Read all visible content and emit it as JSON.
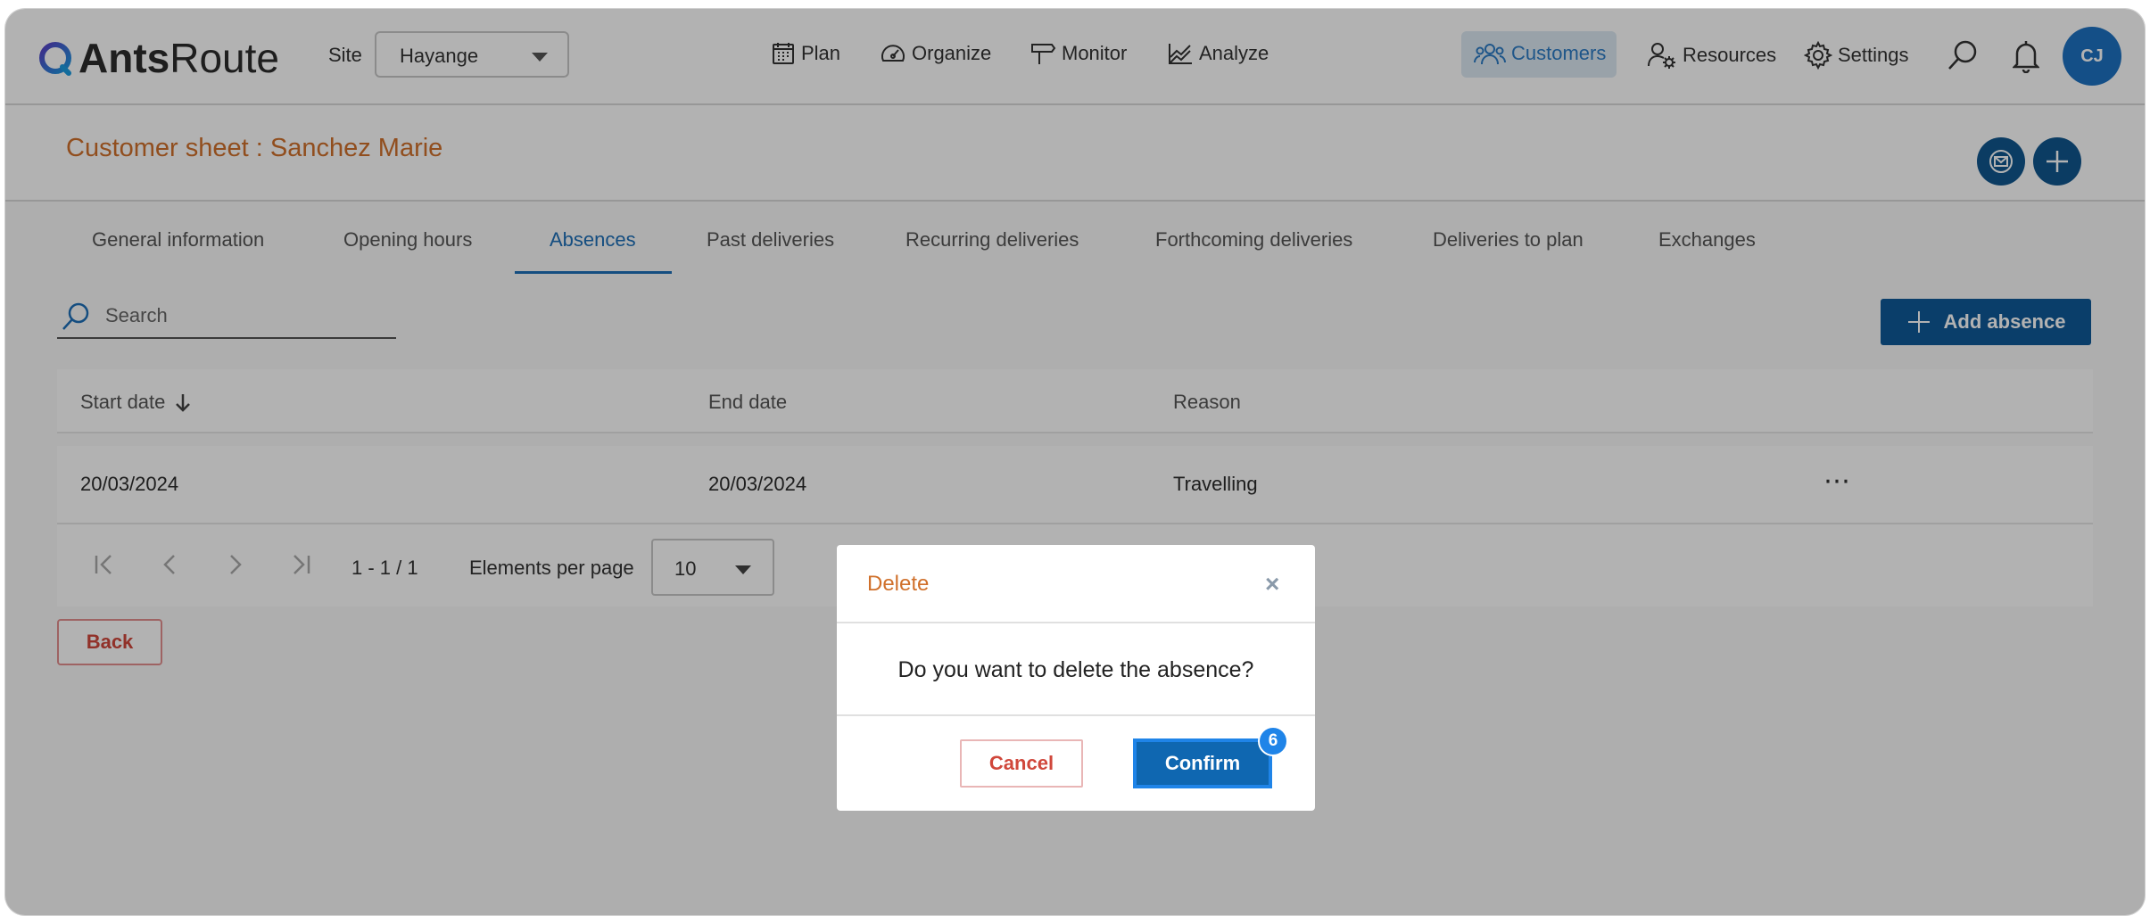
{
  "app": {
    "logo_bold": "Ants",
    "logo_light": "Route"
  },
  "topbar": {
    "site_label": "Site",
    "site_value": "Hayange",
    "nav": {
      "plan": "Plan",
      "organize": "Organize",
      "monitor": "Monitor",
      "analyze": "Analyze",
      "customers": "Customers",
      "resources": "Resources",
      "settings": "Settings"
    },
    "avatar_initials": "CJ",
    "accent_color": "#1d72c2"
  },
  "page": {
    "title": "Customer sheet : Sanchez Marie"
  },
  "tabs": [
    {
      "label": "General information"
    },
    {
      "label": "Opening hours"
    },
    {
      "label": "Absences",
      "active": true
    },
    {
      "label": "Past deliveries"
    },
    {
      "label": "Recurring deliveries"
    },
    {
      "label": "Forthcoming deliveries"
    },
    {
      "label": "Deliveries to plan"
    },
    {
      "label": "Exchanges"
    }
  ],
  "search": {
    "placeholder": "Search"
  },
  "add_absence_label": "Add absence",
  "table": {
    "headers": {
      "start": "Start date",
      "end": "End date",
      "reason": "Reason"
    },
    "rows": [
      {
        "start": "20/03/2024",
        "end": "20/03/2024",
        "reason": "Travelling",
        "actions": "⋯"
      }
    ]
  },
  "pagination": {
    "range": "1 - 1 / 1",
    "per_page_label": "Elements per page",
    "per_page_value": "10"
  },
  "back_label": "Back",
  "dialog": {
    "title": "Delete",
    "close": "×",
    "message": "Do you want to delete the absence?",
    "cancel_label": "Cancel",
    "confirm_label": "Confirm",
    "badge": "6"
  }
}
